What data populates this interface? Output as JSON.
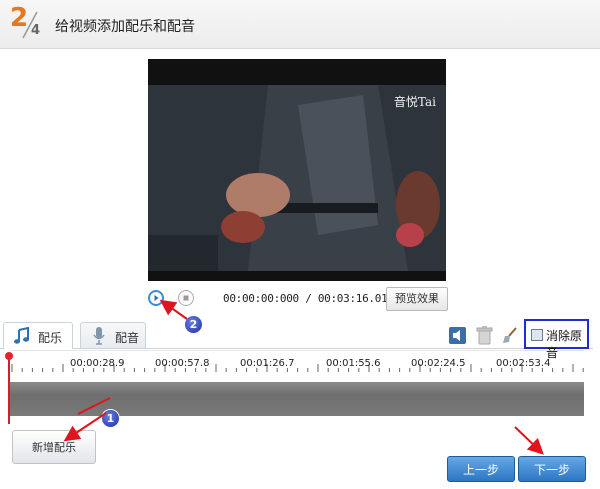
{
  "header": {
    "step_current": "2",
    "step_total": "4",
    "title": "给视频添加配乐和配音"
  },
  "video": {
    "caption": "音悦Tai"
  },
  "player": {
    "play_icon": "play-icon",
    "stop_icon": "stop-icon",
    "time": "00:00:00:000 / 00:03:16.010",
    "preview_label": "预览效果"
  },
  "tabs": [
    {
      "label": "配乐",
      "icon": "music-note-icon",
      "active": true
    },
    {
      "label": "配音",
      "icon": "microphone-icon",
      "active": false
    }
  ],
  "tools": {
    "speaker_icon": "speaker-icon",
    "trash_icon": "trash-icon",
    "brush_icon": "brush-icon",
    "remove_audio_label": "消除原音",
    "remove_audio_checked": false
  },
  "timeline": {
    "ticks": [
      "00:00:28.9",
      "00:00:57.8",
      "00:01:26.7",
      "00:01:55.6",
      "00:02:24.5",
      "00:02:53.4"
    ]
  },
  "buttons": {
    "add_music": "新增配乐",
    "prev": "上一步",
    "next": "下一步"
  },
  "annotations": {
    "badge_1": "1",
    "badge_2": "2",
    "arrow_color": "#e0141e"
  },
  "colors": {
    "accent_orange": "#e8761d",
    "accent_blue": "#2d76c2",
    "highlight_border": "#1f2bd6"
  }
}
